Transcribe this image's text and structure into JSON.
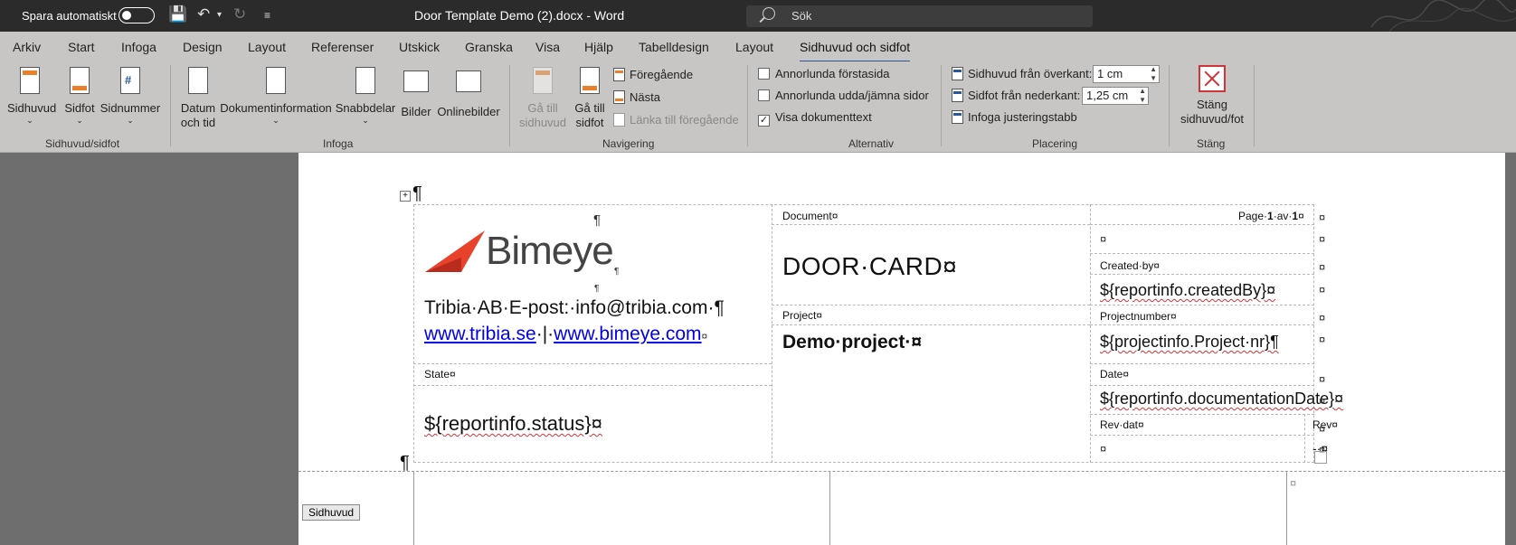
{
  "titlebar": {
    "autosave_label": "Spara automatiskt",
    "doc_title": "Door Template Demo (2).docx  -  Word",
    "search_placeholder": "Sök"
  },
  "tabs": [
    "Arkiv",
    "Start",
    "Infoga",
    "Design",
    "Layout",
    "Referenser",
    "Utskick",
    "Granska",
    "Visa",
    "Hjälp",
    "Tabelldesign",
    "Layout",
    "Sidhuvud och sidfot"
  ],
  "ribbon": {
    "groups": {
      "header_footer": "Sidhuvud/sidfot",
      "insert": "Infoga",
      "navigation": "Navigering",
      "options": "Alternativ",
      "position": "Placering",
      "close": "Stäng"
    },
    "buttons": {
      "header": "Sidhuvud",
      "footer": "Sidfot",
      "page_number": "Sidnummer",
      "date_time_1": "Datum",
      "date_time_2": "och tid",
      "doc_info": "Dokumentinformation",
      "quick_parts": "Snabbdelar",
      "pictures": "Bilder",
      "online_pictures": "Onlinebilder",
      "goto_header_1": "Gå till",
      "goto_header_2": "sidhuvud",
      "goto_footer_1": "Gå till",
      "goto_footer_2": "sidfot",
      "previous": "Föregående",
      "next": "Nästa",
      "link_previous": "Länka till föregående",
      "close_1": "Stäng",
      "close_2": "sidhuvud/fot"
    },
    "options": {
      "different_first": "Annorlunda förstasida",
      "different_odd_even": "Annorlunda udda/jämna sidor",
      "show_doc_text": "Visa dokumenttext",
      "show_doc_text_checked": true
    },
    "position": {
      "header_from_top": "Sidhuvud från överkant:",
      "header_from_top_value": "1 cm",
      "footer_from_bottom": "Sidfot från nederkant:",
      "footer_from_bottom_value": "1,25 cm",
      "insert_align_tab": "Infoga justeringstabb"
    }
  },
  "document": {
    "pilcrow": "¶",
    "cellmark": "¤",
    "logo_text": "Bimeye",
    "company_line": "Tribia·AB·E-post:·info@tribia.com·¶",
    "link1": "www.tribia.se",
    "link_sep": "·|·",
    "link2": "www.bimeye.com",
    "document_label": "Document¤",
    "page_prefix": "Page·",
    "page_num": "1",
    "page_of": "·av·",
    "page_total": "1",
    "title": "DOOR·CARD¤",
    "created_by_label": "Created·by¤",
    "created_by_value": "${reportinfo.createdBy}¤",
    "project_label": "Project¤",
    "project_value": "Demo·project·¤",
    "projectnumber_label": "Projectnumber¤",
    "projectnumber_value": "${projectinfo.Project·nr}¶",
    "state_label": "State¤",
    "state_value": "${reportinfo.status}¤",
    "date_label": "Date¤",
    "date_value": "${reportinfo.documentationDate}¤",
    "revdate_label": "Rev·dat¤",
    "rev_label": "Rev¤",
    "rev_value": "-·¤",
    "header_tag": "Sidhuvud"
  }
}
